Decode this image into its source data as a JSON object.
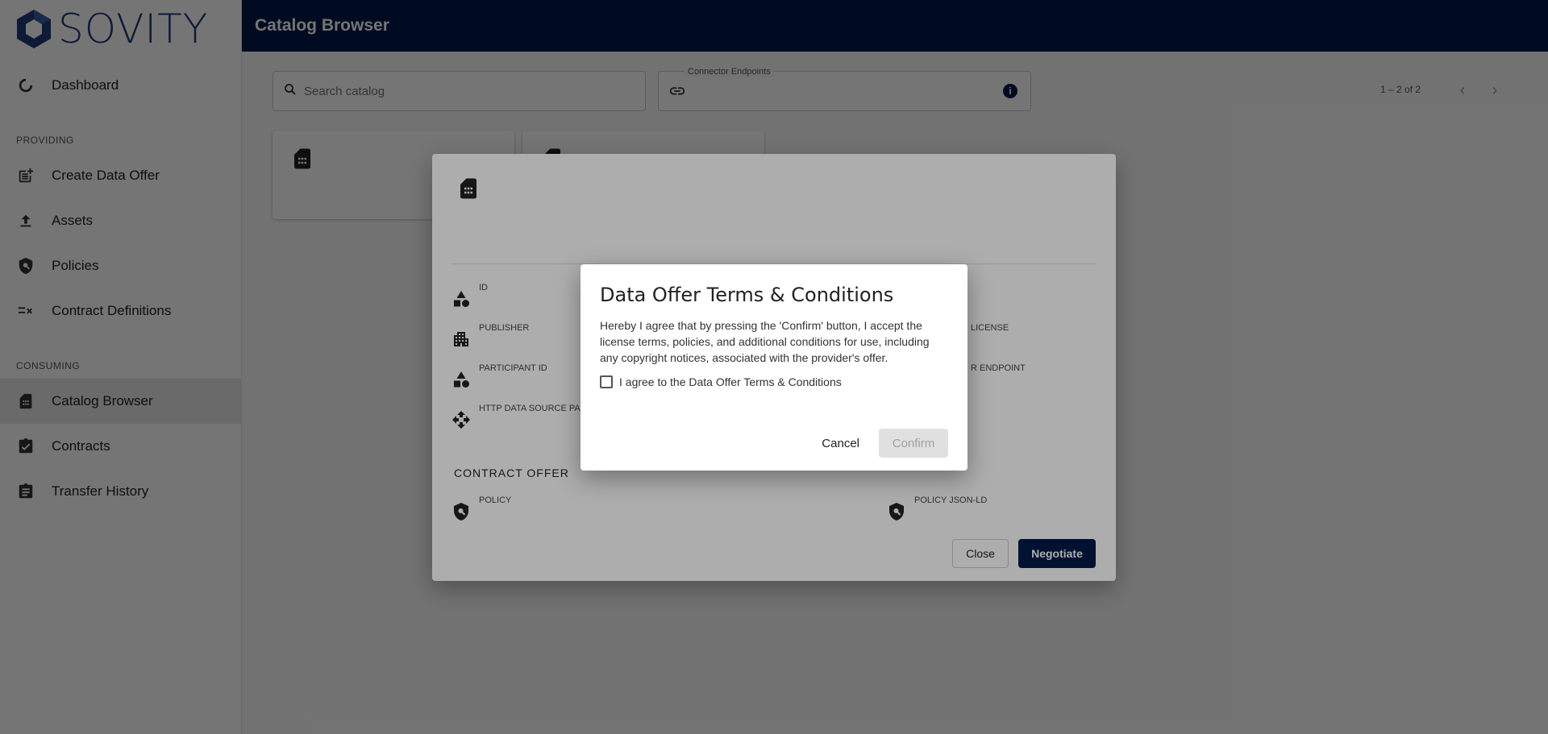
{
  "brand": {
    "logo_text": "SOVITY",
    "accent": "#021a49"
  },
  "sidebar": {
    "items": [
      {
        "label": "Dashboard",
        "icon": "dashboard-icon"
      },
      {
        "label": "Create Data Offer",
        "icon": "post-add-icon"
      },
      {
        "label": "Assets",
        "icon": "upload-icon"
      },
      {
        "label": "Policies",
        "icon": "policy-icon"
      },
      {
        "label": "Contract Definitions",
        "icon": "rule-icon"
      },
      {
        "label": "Catalog Browser",
        "icon": "sim-card-icon",
        "active": true
      },
      {
        "label": "Contracts",
        "icon": "assignment-turned-in-icon"
      },
      {
        "label": "Transfer History",
        "icon": "assignment-icon"
      }
    ],
    "sections": {
      "providing": "PROVIDING",
      "consuming": "CONSUMING"
    }
  },
  "header": {
    "title": "Catalog Browser"
  },
  "main": {
    "search_placeholder": "Search catalog",
    "endpoints_label": "Connector Endpoints",
    "paginator": "1 – 2 of 2"
  },
  "detail_dialog": {
    "props": {
      "id": "ID",
      "publisher": "PUBLISHER",
      "participant_id": "PARTICIPANT ID",
      "http_params": "HTTP DATA SOURCE PA",
      "license": "LICENSE",
      "endpoint": "R ENDPOINT"
    },
    "contract_offer_title": "CONTRACT OFFER",
    "policy_label": "POLICY",
    "policy_jsonld_label": "POLICY JSON-LD",
    "close_label": "Close",
    "negotiate_label": "Negotiate"
  },
  "terms_dialog": {
    "title": "Data Offer Terms & Conditions",
    "text": "Hereby I agree that by pressing the 'Confirm' button, I accept the license terms, policies, and additional conditions for use, including any copyright notices, associated with the provider's offer.",
    "checkbox_label": "I agree to the Data Offer Terms & Conditions",
    "cancel_label": "Cancel",
    "confirm_label": "Confirm"
  }
}
